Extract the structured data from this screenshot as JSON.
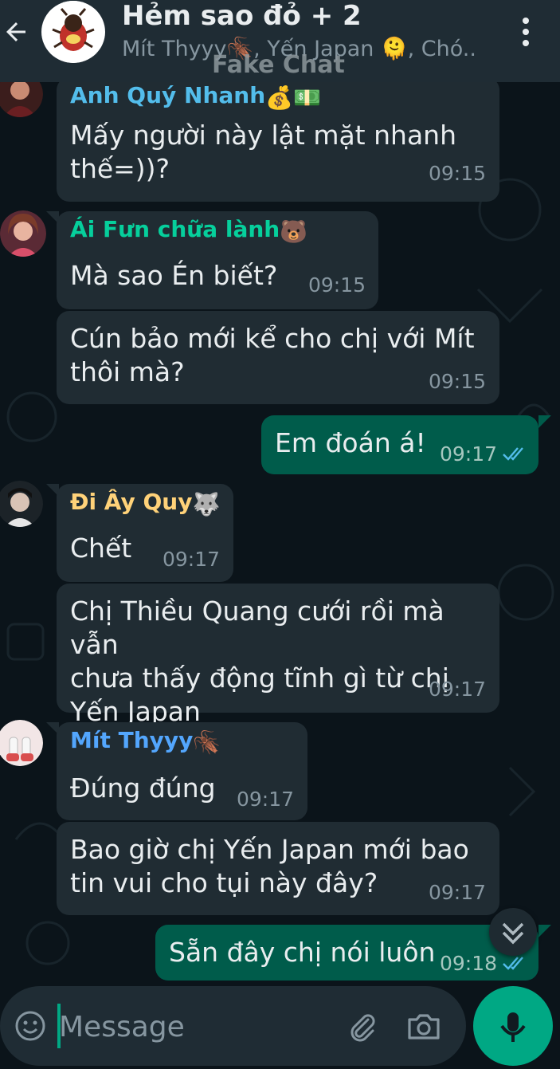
{
  "header": {
    "title": "Hẻm sao đỏ + 2",
    "subtitle": "Mít Thyyy🪳, Yến Japan 🫠, Chó...",
    "watermark": "Fake Chat",
    "icons": {
      "back": "arrow-left-icon",
      "menu": "more-vertical-icon"
    }
  },
  "messages": [
    {
      "sender": "Anh Quý Nhanh",
      "sender_emoji": "💰💵",
      "sender_color": "#53bdeb",
      "text": "Mấy người này lật mặt nhanh\nthế=))?",
      "time": "09:15"
    },
    {
      "sender": "Ái Fưn chữa lành",
      "sender_emoji": "🐻",
      "sender_color": "#06cf9c",
      "text": "Mà sao Én biết?",
      "time": "09:15"
    },
    {
      "text": "Cún bảo mới kể cho chị với Mít\nthôi mà?",
      "time": "09:15"
    },
    {
      "out": true,
      "text": "Em đoán á!",
      "time": "09:17"
    },
    {
      "sender": "Đi Ây Quy",
      "sender_emoji": "🐺",
      "sender_color": "#ffd279",
      "text": "Chết",
      "time": "09:17"
    },
    {
      "text": "Chị Thiều Quang cưới rồi mà vẫn\nchưa thấy động tĩnh gì từ chị\nYến Japan",
      "time": "09:17"
    },
    {
      "sender": "Mít Thyyy",
      "sender_emoji": "🪳",
      "sender_color": "#53a6fd",
      "text": "Đúng đúng",
      "time": "09:17"
    },
    {
      "text": "Bao giờ chị Yến Japan mới bao\ntin vui cho tụi này đây?",
      "time": "09:17"
    },
    {
      "out": true,
      "text": "Sẵn đây chị nói luôn",
      "time": "09:18"
    }
  ],
  "composer": {
    "placeholder": "Message",
    "icons": {
      "emoji": "smiley-icon",
      "attach": "paperclip-icon",
      "camera": "camera-icon",
      "mic": "microphone-icon"
    }
  },
  "colors": {
    "background": "#0b141a",
    "incoming": "#202c33",
    "outgoing": "#005c4b",
    "accent": "#00a884",
    "read_ticks": "#53bdeb"
  }
}
